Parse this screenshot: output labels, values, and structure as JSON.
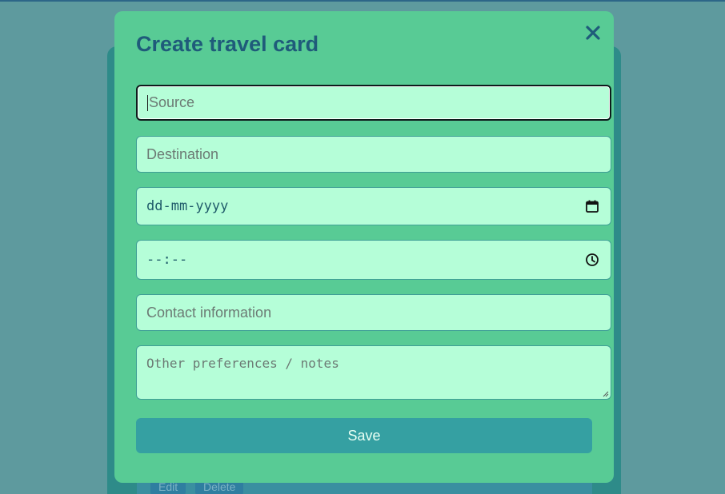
{
  "background": {
    "edit_label": "Edit",
    "delete_label": "Delete"
  },
  "modal": {
    "title": "Create travel card",
    "close_icon": "close-icon",
    "fields": {
      "source_placeholder": "Source",
      "destination_placeholder": "Destination",
      "date_placeholder": "dd-mm-yyyy",
      "time_placeholder": "--:--",
      "contact_placeholder": "Contact information",
      "notes_placeholder": "Other preferences / notes"
    },
    "save_label": "Save"
  },
  "colors": {
    "page_bg": "#5e9a9e",
    "modal_bg": "#58cb95",
    "field_bg": "#b5fed8",
    "title": "#1f5b7a",
    "save_button": "#35a0a2"
  }
}
